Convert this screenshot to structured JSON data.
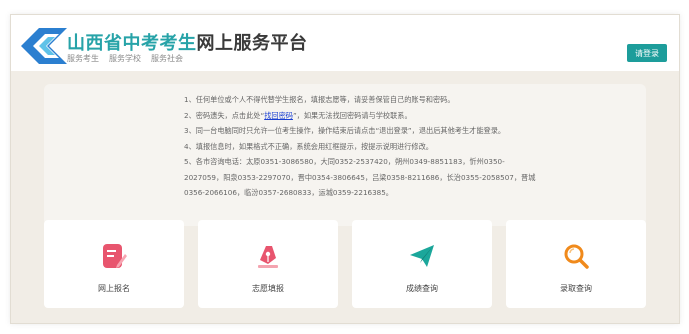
{
  "header": {
    "title_part1": "山西省中考考生",
    "title_part2": "网上服务平台",
    "subnav": [
      "服务考生",
      "服务学校",
      "服务社会"
    ],
    "login_label": "请登录"
  },
  "notice": {
    "line1": "1、任何单位或个人不得代替学生报名，填报志愿等，请妥善保管自己的账号和密码。",
    "line2_pre": "2、密码遗失，点击此处“",
    "line2_link": "找回密码",
    "line2_post": "”，如果无法找回密码请与学校联系。",
    "line3": "3、同一台电脑同时只允许一位考生操作，操作结束后请点击“退出登录”，退出后其他考生才能登录。",
    "line4": "4、填报信息时，如果格式不正确，系统会用红框提示，按提示说明进行修改。",
    "line5": "5、各市咨询电话：太原0351-3086580，大同0352-2537420，朔州0349-8851183，忻州0350-",
    "line6": "2027059，阳泉0353-2297070，晋中0354-3806645，吕梁0358-8211686，长治0355-2058507，晋城",
    "line7": "0356-2066106，临汾0357-2680833，运城0359-2216385。"
  },
  "cards": [
    {
      "label": "网上报名",
      "icon": "edit-icon",
      "color": "#e8556e"
    },
    {
      "label": "志愿填报",
      "icon": "pen-nib-icon",
      "color": "#e8556e"
    },
    {
      "label": "成绩查询",
      "icon": "paper-plane-icon",
      "color": "#1ba79b"
    },
    {
      "label": "录取查询",
      "icon": "search-icon",
      "color": "#f08a1c"
    }
  ],
  "colors": {
    "brand_teal": "#27a3a8",
    "button_teal": "#1d9d9b",
    "background": "#f1ede6",
    "link_blue": "#1a3fd1"
  }
}
